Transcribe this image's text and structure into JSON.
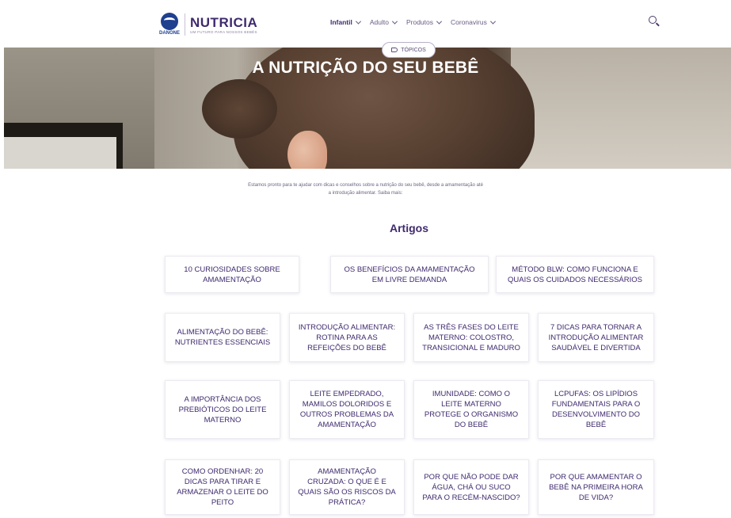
{
  "brand": {
    "parent": "DANONE",
    "name": "NUTRICIA",
    "tagline": "UM FUTURO PARA NOSSOS BEBÊS"
  },
  "nav": {
    "items": [
      {
        "label": "Infantil"
      },
      {
        "label": "Adulto"
      },
      {
        "label": "Produtos"
      },
      {
        "label": "Coronavirus"
      }
    ]
  },
  "hero": {
    "pill_label": "TÓPICOS",
    "title": "A NUTRIÇÃO DO SEU BEBÊ"
  },
  "intro": {
    "line1": "Estamos pronto para te ajudar com dicas e conselhos sobre a nutrição do seu bebê, desde a amamentação até",
    "line2": "a introdução alimentar. Saiba mais:"
  },
  "articles_title": "Artigos",
  "articles": [
    {
      "title": "10 CURIOSIDADES SOBRE AMAMENTAÇÃO"
    },
    {
      "title": "OS BENEFÍCIOS DA AMAMENTAÇÃO EM LIVRE DEMANDA"
    },
    {
      "title": "MÉTODO BLW: COMO FUNCIONA E QUAIS OS CUIDADOS NECESSÁRIOS"
    },
    {
      "title": "ALIMENTAÇÃO DO BEBÊ: NUTRIENTES ESSENCIAIS"
    },
    {
      "title": "INTRODUÇÃO ALIMENTAR: ROTINA PARA AS REFEIÇÕES DO BEBÊ"
    },
    {
      "title": "AS TRÊS FASES DO LEITE MATERNO: COLOSTRO, TRANSICIONAL E MADURO"
    },
    {
      "title": "7 DICAS PARA TORNAR A INTRODUÇÃO ALIMENTAR SAUDÁVEL E DIVERTIDA"
    },
    {
      "title": "A IMPORTÂNCIA DOS PREBIÓTICOS DO LEITE MATERNO"
    },
    {
      "title": "LEITE EMPEDRADO, MAMILOS DOLORIDOS E OUTROS PROBLEMAS DA AMAMENTAÇÃO"
    },
    {
      "title": "IMUNIDADE: COMO O LEITE MATERNO PROTEGE O ORGANISMO DO BEBÊ"
    },
    {
      "title": "LCPUFAS: OS LIPÍDIOS FUNDAMENTAIS PARA O DESENVOLVIMENTO DO BEBÊ"
    },
    {
      "title": "COMO ORDENHAR: 20 DICAS PARA TIRAR E ARMAZENAR O LEITE DO PEITO"
    },
    {
      "title": "AMAMENTAÇÃO CRUZADA: O QUE É E QUAIS SÃO OS RISCOS DA PRÁTICA?"
    },
    {
      "title": "POR QUE NÃO PODE DAR ÁGUA, CHÁ OU SUCO PARA O RECÉM-NASCIDO?"
    },
    {
      "title": "POR QUE AMAMENTAR O BEBÊ NA PRIMEIRA HORA DE VIDA?"
    }
  ],
  "colors": {
    "brand_purple": "#3f2a6e",
    "danone_blue": "#1f3f8f"
  },
  "icons": {
    "search": "search-icon",
    "topics": "tag-icon",
    "dropdown": "chevron-down-icon"
  }
}
